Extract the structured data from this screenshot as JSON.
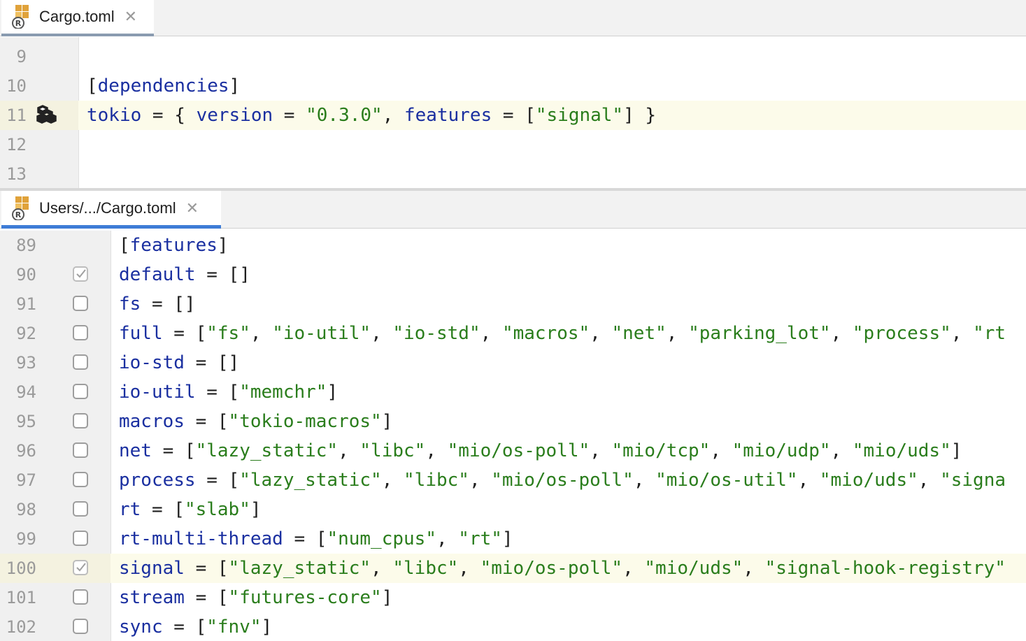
{
  "top_pane": {
    "tab": {
      "icon": "rust-toml-file-icon",
      "label": "Cargo.toml",
      "close": "✕"
    },
    "lines": [
      {
        "num": "9",
        "tokens": []
      },
      {
        "num": "10",
        "tokens": [
          {
            "t": "[",
            "c": "p"
          },
          {
            "t": "dependencies",
            "c": "k"
          },
          {
            "t": "]",
            "c": "p"
          }
        ]
      },
      {
        "num": "11",
        "highlight": true,
        "gutter_icon": "crate-icon",
        "tokens": [
          {
            "t": "tokio",
            "c": "k"
          },
          {
            "t": " = { ",
            "c": "p"
          },
          {
            "t": "version",
            "c": "k"
          },
          {
            "t": " = ",
            "c": "p"
          },
          {
            "t": "\"0.3.0\"",
            "c": "s"
          },
          {
            "t": ", ",
            "c": "p"
          },
          {
            "t": "features",
            "c": "k"
          },
          {
            "t": " = [",
            "c": "p"
          },
          {
            "t": "\"signal\"",
            "c": "s"
          },
          {
            "t": "] }",
            "c": "p"
          }
        ]
      },
      {
        "num": "12",
        "tokens": []
      },
      {
        "num": "13",
        "tokens": []
      }
    ]
  },
  "bottom_pane": {
    "tab": {
      "icon": "rust-toml-file-icon",
      "label": "Users/.../Cargo.toml",
      "close": "✕"
    },
    "lines": [
      {
        "num": "89",
        "tokens": [
          {
            "t": "[",
            "c": "p"
          },
          {
            "t": "features",
            "c": "k"
          },
          {
            "t": "]",
            "c": "p"
          }
        ]
      },
      {
        "num": "90",
        "checkbox": "checked-disabled",
        "tokens": [
          {
            "t": "default",
            "c": "k"
          },
          {
            "t": " = []",
            "c": "p"
          }
        ]
      },
      {
        "num": "91",
        "checkbox": "unchecked",
        "tokens": [
          {
            "t": "fs",
            "c": "k"
          },
          {
            "t": " = []",
            "c": "p"
          }
        ]
      },
      {
        "num": "92",
        "checkbox": "unchecked",
        "tokens": [
          {
            "t": "full",
            "c": "k"
          },
          {
            "t": " = [",
            "c": "p"
          },
          {
            "t": "\"fs\"",
            "c": "s"
          },
          {
            "t": ", ",
            "c": "p"
          },
          {
            "t": "\"io-util\"",
            "c": "s"
          },
          {
            "t": ", ",
            "c": "p"
          },
          {
            "t": "\"io-std\"",
            "c": "s"
          },
          {
            "t": ", ",
            "c": "p"
          },
          {
            "t": "\"macros\"",
            "c": "s"
          },
          {
            "t": ", ",
            "c": "p"
          },
          {
            "t": "\"net\"",
            "c": "s"
          },
          {
            "t": ", ",
            "c": "p"
          },
          {
            "t": "\"parking_lot\"",
            "c": "s"
          },
          {
            "t": ", ",
            "c": "p"
          },
          {
            "t": "\"process\"",
            "c": "s"
          },
          {
            "t": ", ",
            "c": "p"
          },
          {
            "t": "\"rt",
            "c": "s"
          }
        ]
      },
      {
        "num": "93",
        "checkbox": "unchecked",
        "tokens": [
          {
            "t": "io-std",
            "c": "k"
          },
          {
            "t": " = []",
            "c": "p"
          }
        ]
      },
      {
        "num": "94",
        "checkbox": "unchecked",
        "tokens": [
          {
            "t": "io-util",
            "c": "k"
          },
          {
            "t": " = [",
            "c": "p"
          },
          {
            "t": "\"memchr\"",
            "c": "s"
          },
          {
            "t": "]",
            "c": "p"
          }
        ]
      },
      {
        "num": "95",
        "checkbox": "unchecked",
        "tokens": [
          {
            "t": "macros",
            "c": "k"
          },
          {
            "t": " = [",
            "c": "p"
          },
          {
            "t": "\"tokio-macros\"",
            "c": "s"
          },
          {
            "t": "]",
            "c": "p"
          }
        ]
      },
      {
        "num": "96",
        "checkbox": "unchecked",
        "tokens": [
          {
            "t": "net",
            "c": "k"
          },
          {
            "t": " = [",
            "c": "p"
          },
          {
            "t": "\"lazy_static\"",
            "c": "s"
          },
          {
            "t": ", ",
            "c": "p"
          },
          {
            "t": "\"libc\"",
            "c": "s"
          },
          {
            "t": ", ",
            "c": "p"
          },
          {
            "t": "\"mio/os-poll\"",
            "c": "s"
          },
          {
            "t": ", ",
            "c": "p"
          },
          {
            "t": "\"mio/tcp\"",
            "c": "s"
          },
          {
            "t": ", ",
            "c": "p"
          },
          {
            "t": "\"mio/udp\"",
            "c": "s"
          },
          {
            "t": ", ",
            "c": "p"
          },
          {
            "t": "\"mio/uds\"",
            "c": "s"
          },
          {
            "t": "]",
            "c": "p"
          }
        ]
      },
      {
        "num": "97",
        "checkbox": "unchecked",
        "tokens": [
          {
            "t": "process",
            "c": "k"
          },
          {
            "t": " = [",
            "c": "p"
          },
          {
            "t": "\"lazy_static\"",
            "c": "s"
          },
          {
            "t": ", ",
            "c": "p"
          },
          {
            "t": "\"libc\"",
            "c": "s"
          },
          {
            "t": ", ",
            "c": "p"
          },
          {
            "t": "\"mio/os-poll\"",
            "c": "s"
          },
          {
            "t": ", ",
            "c": "p"
          },
          {
            "t": "\"mio/os-util\"",
            "c": "s"
          },
          {
            "t": ", ",
            "c": "p"
          },
          {
            "t": "\"mio/uds\"",
            "c": "s"
          },
          {
            "t": ", ",
            "c": "p"
          },
          {
            "t": "\"signa",
            "c": "s"
          }
        ]
      },
      {
        "num": "98",
        "checkbox": "unchecked",
        "tokens": [
          {
            "t": "rt",
            "c": "k"
          },
          {
            "t": " = [",
            "c": "p"
          },
          {
            "t": "\"slab\"",
            "c": "s"
          },
          {
            "t": "]",
            "c": "p"
          }
        ]
      },
      {
        "num": "99",
        "checkbox": "unchecked",
        "tokens": [
          {
            "t": "rt-multi-thread",
            "c": "k"
          },
          {
            "t": " = [",
            "c": "p"
          },
          {
            "t": "\"num_cpus\"",
            "c": "s"
          },
          {
            "t": ", ",
            "c": "p"
          },
          {
            "t": "\"rt\"",
            "c": "s"
          },
          {
            "t": "]",
            "c": "p"
          }
        ]
      },
      {
        "num": "100",
        "highlight": true,
        "checkbox": "checked-disabled",
        "tokens": [
          {
            "t": "signal",
            "c": "k"
          },
          {
            "t": " = [",
            "c": "p"
          },
          {
            "t": "\"lazy_static\"",
            "c": "s"
          },
          {
            "t": ", ",
            "c": "p"
          },
          {
            "t": "\"libc\"",
            "c": "s"
          },
          {
            "t": ", ",
            "c": "p"
          },
          {
            "t": "\"mio/os-poll\"",
            "c": "s"
          },
          {
            "t": ", ",
            "c": "p"
          },
          {
            "t": "\"mio/uds\"",
            "c": "s"
          },
          {
            "t": ", ",
            "c": "p"
          },
          {
            "t": "\"signal-hook-registry\"",
            "c": "s"
          }
        ]
      },
      {
        "num": "101",
        "checkbox": "unchecked",
        "tokens": [
          {
            "t": "stream",
            "c": "k"
          },
          {
            "t": " = [",
            "c": "p"
          },
          {
            "t": "\"futures-core\"",
            "c": "s"
          },
          {
            "t": "]",
            "c": "p"
          }
        ]
      },
      {
        "num": "102",
        "checkbox": "unchecked",
        "tokens": [
          {
            "t": "sync",
            "c": "k"
          },
          {
            "t": " = [",
            "c": "p"
          },
          {
            "t": "\"fnv\"",
            "c": "s"
          },
          {
            "t": "]",
            "c": "p"
          }
        ]
      }
    ]
  },
  "colors": {
    "keyword": "#1a2fa0",
    "string": "#2a7d1c",
    "active_tab_underline": "#3e7cd6",
    "line_highlight": "#fcfbea"
  }
}
